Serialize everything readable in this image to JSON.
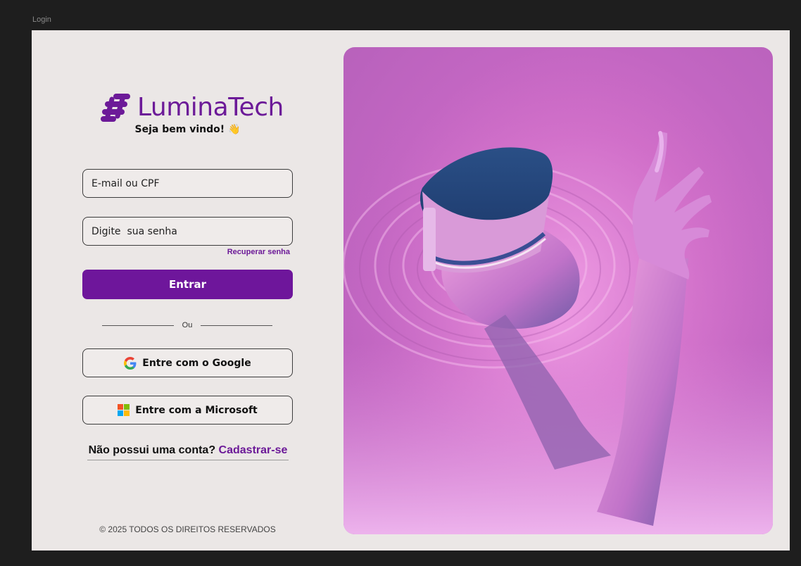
{
  "frame": {
    "label": "Login"
  },
  "brand": {
    "name": "LuminaTech",
    "color": "#6c1a98",
    "logo_icon": "molecule-cluster-icon"
  },
  "welcome": {
    "text": "Seja bem vindo!",
    "emoji": "👋"
  },
  "form": {
    "email_placeholder": "E-mail ou CPF",
    "password_placeholder": "Digite  sua senha",
    "recover_label": "Recuperar senha",
    "submit_label": "Entrar"
  },
  "divider": {
    "label": "Ou"
  },
  "social": {
    "google_label": "Entre com o Google",
    "google_icon": "google-g-icon",
    "microsoft_label": "Entre com a Microsoft",
    "microsoft_icon": "microsoft-logo-icon"
  },
  "signup": {
    "prompt": "Não possui uma conta?",
    "link": "Cadastrar-se"
  },
  "footer": {
    "copyright": "© 2025 TODOS OS DIREITOS RESERVADOS"
  },
  "colors": {
    "primary": "#6e169b",
    "background": "#ebe7e6",
    "hero_pink": "#d06dc8"
  }
}
